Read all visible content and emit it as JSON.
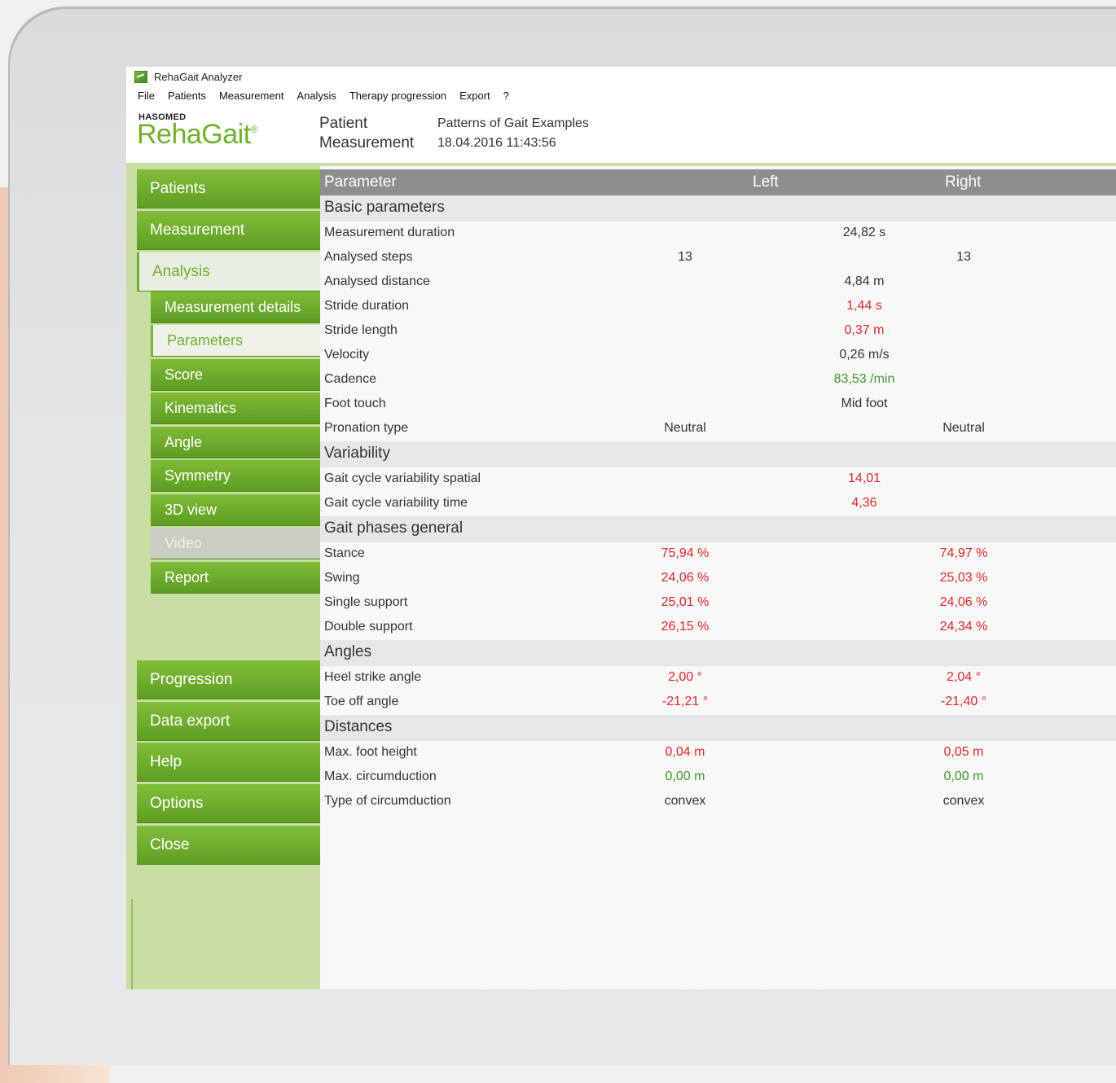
{
  "window": {
    "title": "RehaGait Analyzer"
  },
  "menu": [
    "File",
    "Patients",
    "Measurement",
    "Analysis",
    "Therapy progression",
    "Export",
    "?"
  ],
  "brand": {
    "company": "HASOMED",
    "product": "RehaGait",
    "mark": "®"
  },
  "header": {
    "patient_label": "Patient",
    "measurement_label": "Measurement",
    "patient_value": "Patterns of Gait Examples",
    "measurement_value": "18.04.2016 11:43:56"
  },
  "sidebar": {
    "main": [
      "Patients",
      "Measurement",
      "Analysis"
    ],
    "sub": [
      "Measurement details",
      "Parameters",
      "Score",
      "Kinematics",
      "Angle",
      "Symmetry",
      "3D view",
      "Video",
      "Report"
    ],
    "lower": [
      "Progression",
      "Data export",
      "Help",
      "Options",
      "Close"
    ],
    "active_main": "Analysis",
    "active_sub": "Parameters",
    "disabled_sub": "Video"
  },
  "table": {
    "headers": {
      "parameter": "Parameter",
      "left": "Left",
      "right": "Right"
    },
    "sections": [
      {
        "title": "Basic parameters",
        "rows": [
          {
            "name": "Measurement duration",
            "center": "24,82 s",
            "color": ""
          },
          {
            "name": "Analysed steps",
            "left": "13",
            "right": "13",
            "color": ""
          },
          {
            "name": "Analysed distance",
            "center": "4,84 m",
            "color": ""
          },
          {
            "name": "Stride duration",
            "center": "1,44 s",
            "color": "red"
          },
          {
            "name": "Stride length",
            "center": "0,37 m",
            "color": "red"
          },
          {
            "name": "Velocity",
            "center": "0,26 m/s",
            "color": ""
          },
          {
            "name": "Cadence",
            "center": "83,53 /min",
            "color": "green"
          },
          {
            "name": "Foot touch",
            "center": "Mid foot",
            "color": ""
          },
          {
            "name": "Pronation type",
            "left": "Neutral",
            "right": "Neutral",
            "color": ""
          }
        ]
      },
      {
        "title": "Variability",
        "rows": [
          {
            "name": "Gait cycle variability spatial",
            "center": "14,01",
            "color": "red"
          },
          {
            "name": "Gait cycle variability time",
            "center": "4,36",
            "color": "red"
          }
        ]
      },
      {
        "title": "Gait phases general",
        "rows": [
          {
            "name": "Stance",
            "left": "75,94 %",
            "right": "74,97 %",
            "color": "red"
          },
          {
            "name": "Swing",
            "left": "24,06 %",
            "right": "25,03 %",
            "color": "red"
          },
          {
            "name": "Single support",
            "left": "25,01 %",
            "right": "24,06 %",
            "color": "red"
          },
          {
            "name": "Double support",
            "left": "26,15 %",
            "right": "24,34 %",
            "color": "red"
          }
        ]
      },
      {
        "title": "Angles",
        "rows": [
          {
            "name": "Heel strike angle",
            "left": "2,00 °",
            "right": "2,04 °",
            "color": "red"
          },
          {
            "name": "Toe off angle",
            "left": "-21,21 °",
            "right": "-21,40 °",
            "color": "red"
          }
        ]
      },
      {
        "title": "Distances",
        "rows": [
          {
            "name": "Max. foot height",
            "left": "0,04 m",
            "right": "0,05 m",
            "color": "red"
          },
          {
            "name": "Max. circumduction",
            "left": "0,00 m",
            "right": "0,00 m",
            "color": "green"
          },
          {
            "name": "Type of circumduction",
            "left": "convex",
            "right": "convex",
            "color": ""
          }
        ]
      }
    ]
  },
  "colors": {
    "accent": "#6eb22a",
    "nav_green": "#6fae2c",
    "warn": "#e8232c",
    "ok": "#3a9a2a"
  }
}
